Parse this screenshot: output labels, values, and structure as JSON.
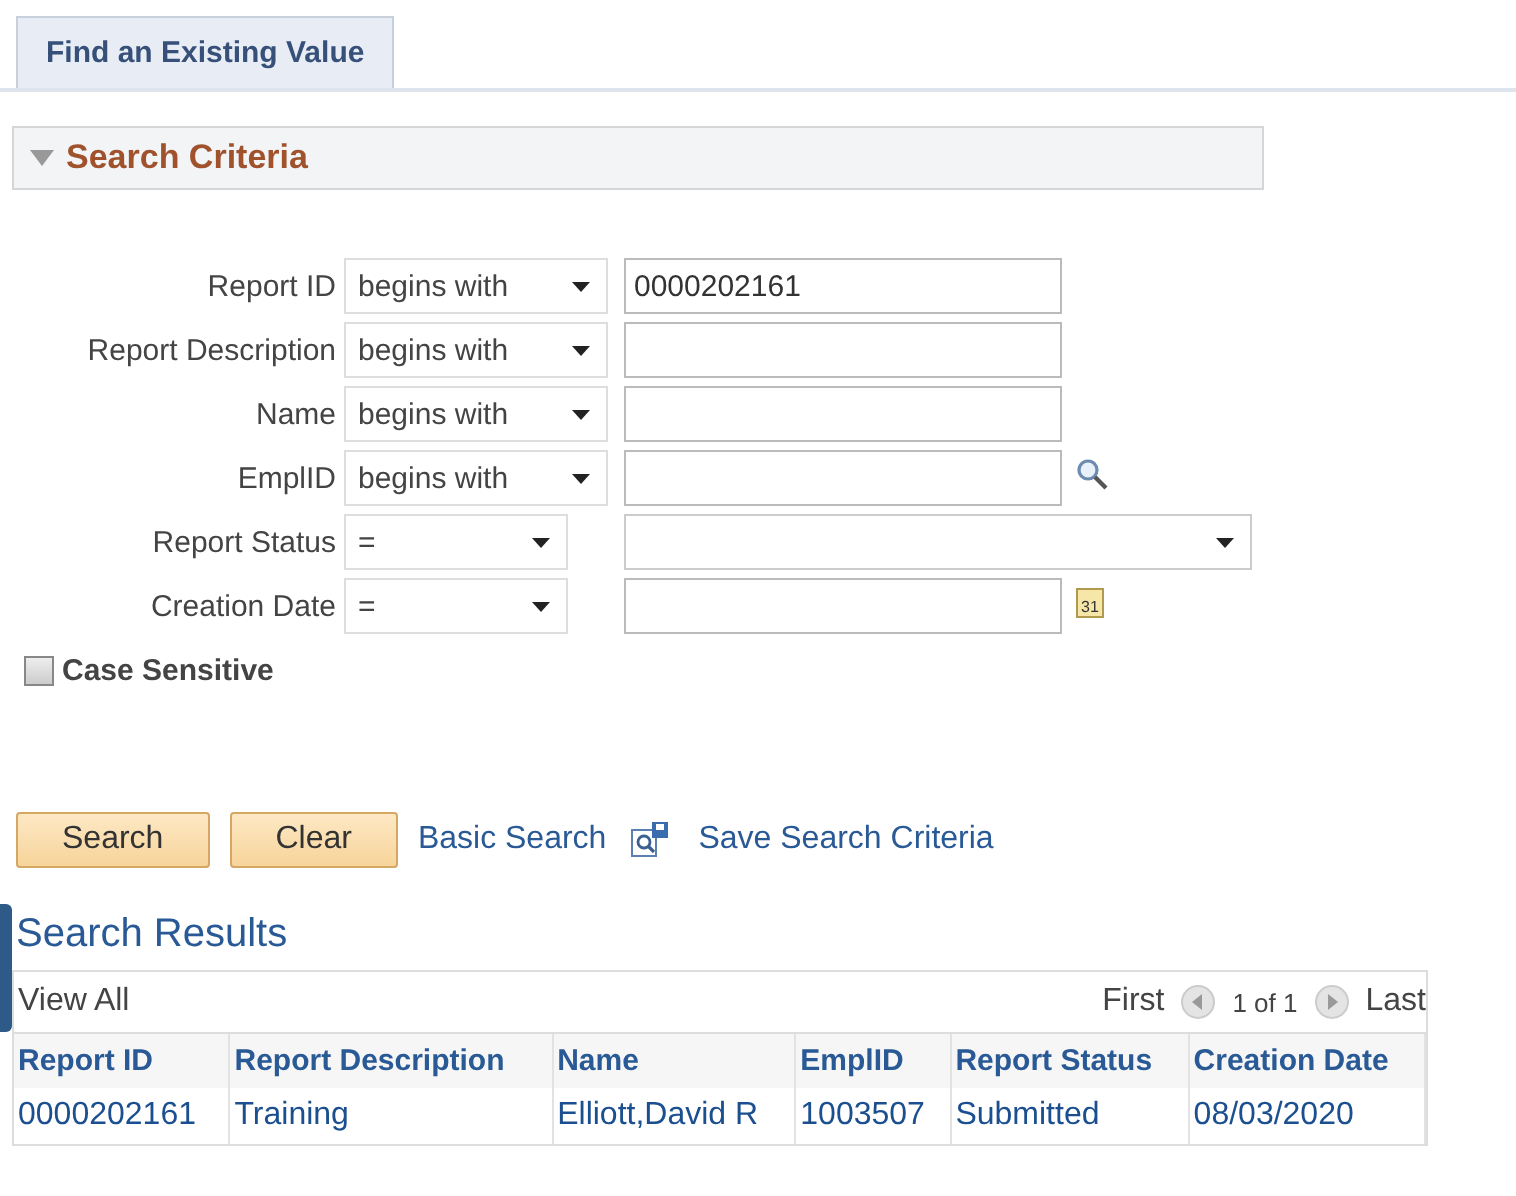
{
  "tab": {
    "label": "Find an Existing Value",
    "selected": true
  },
  "section": {
    "title": "Search Criteria",
    "expanded": true
  },
  "criteria": [
    {
      "label": "Report ID",
      "operator": "begins with",
      "value": "0000202161",
      "kind": "text"
    },
    {
      "label": "Report Description",
      "operator": "begins with",
      "kind": "text"
    },
    {
      "label": "Name",
      "operator": "begins with",
      "kind": "text"
    },
    {
      "label": "EmplID",
      "operator": "begins with",
      "kind": "lookup"
    },
    {
      "label": "Report Status",
      "operator": "=",
      "kind": "dropdown"
    },
    {
      "label": "Creation Date",
      "operator": "=",
      "kind": "date",
      "calendar_day": "31"
    }
  ],
  "case_sensitive": {
    "label": "Case Sensitive",
    "checked": false
  },
  "buttons": [
    "Search",
    "Clear"
  ],
  "links": [
    "Basic Search",
    "Save Search Criteria"
  ],
  "results": {
    "title": "Search Results",
    "view_all": "View All",
    "first": "First",
    "page": "1 of 1",
    "last": "Last",
    "columns": [
      "Report ID",
      "Report Description",
      "Name",
      "EmplID",
      "Report Status",
      "Creation Date"
    ],
    "rows": [
      [
        "0000202161",
        "Training",
        "Elliott,David R",
        "1003507",
        "Submitted",
        "08/03/2020"
      ]
    ]
  }
}
